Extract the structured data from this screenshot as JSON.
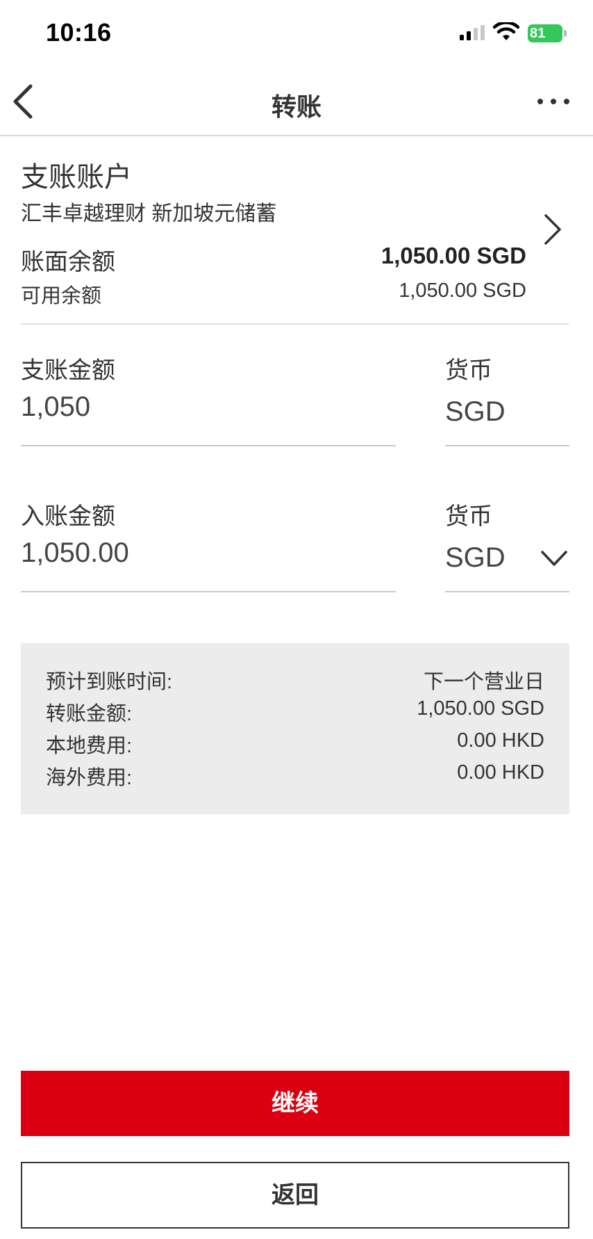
{
  "status_bar": {
    "time": "10:16",
    "battery": "81",
    "battery_color": "#34c759",
    "icons": [
      "signal-icon",
      "wifi-icon",
      "battery-icon"
    ]
  },
  "nav": {
    "title": "转账",
    "back_icon": "chevron-left-icon",
    "more_icon": "more-icon"
  },
  "debit_account": {
    "title": "支账账户",
    "name": "汇丰卓越理财 新加坡元储蓄",
    "ledger_label": "账面余额",
    "ledger_value": "1,050.00 SGD",
    "available_label": "可用余额",
    "available_value": "1,050.00 SGD",
    "chevron_icon": "chevron-right-icon"
  },
  "debit_amount": {
    "label": "支账金额",
    "value": "1,050",
    "currency_label": "货币",
    "currency_value": "SGD"
  },
  "credit_amount": {
    "label": "入账金额",
    "value": "1,050.00",
    "currency_label": "货币",
    "currency_value": "SGD",
    "dropdown_icon": "chevron-down-icon"
  },
  "summary": [
    {
      "label": "预计到账时间:",
      "value": "下一个营业日"
    },
    {
      "label": "转账金额:",
      "value": "1,050.00 SGD"
    },
    {
      "label": "本地费用:",
      "value": "0.00 HKD"
    },
    {
      "label": "海外费用:",
      "value": "0.00 HKD"
    }
  ],
  "buttons": {
    "continue_label": "继续",
    "back_label": "返回"
  },
  "colors": {
    "primary": "#db0011",
    "summary_bg": "#ececec"
  }
}
